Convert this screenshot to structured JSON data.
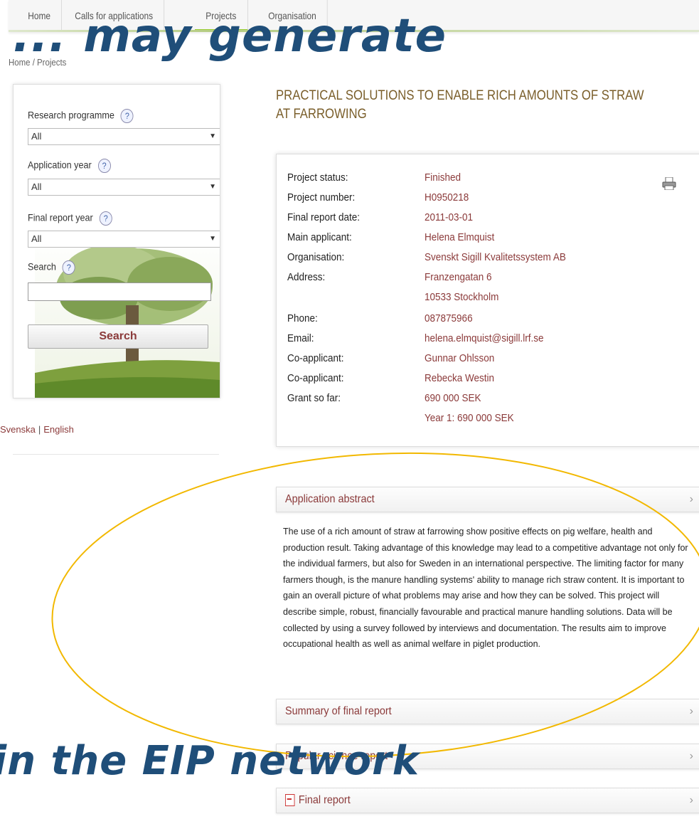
{
  "nav": {
    "items": [
      "Home",
      "Calls for applications",
      "Projects",
      "Organisation"
    ],
    "active": "Projects"
  },
  "overlay": {
    "top_text": "... may generate",
    "bottom_text": "in the EIP network"
  },
  "breadcrumb": "Home / Projects",
  "sidebar": {
    "research_programme_label": "Research programme",
    "research_programme_value": "All",
    "application_year_label": "Application year",
    "application_year_value": "All",
    "final_report_year_label": "Final report year",
    "final_report_year_value": "All",
    "search_label": "Search",
    "search_value": "",
    "search_button": "Search",
    "help_glyph": "?"
  },
  "language": {
    "svenska": "Svenska",
    "separator": "|",
    "english": "English"
  },
  "project": {
    "title": "PRACTICAL SOLUTIONS TO ENABLE RICH AMOUNTS OF STRAW AT FARROWING",
    "rows": [
      {
        "k": "Project status:",
        "v": "Finished"
      },
      {
        "k": "Project number:",
        "v": "H0950218"
      },
      {
        "k": "Final report date:",
        "v": "2011-03-01"
      },
      {
        "k": "Main applicant:",
        "v": "Helena Elmquist"
      },
      {
        "k": "Organisation:",
        "v": "Svenskt Sigill Kvalitetssystem AB"
      },
      {
        "k": "Address:",
        "v": "Franzengatan 6"
      },
      {
        "k": "",
        "v": "10533 Stockholm"
      },
      {
        "k": "Phone:",
        "v": "087875966"
      },
      {
        "k": "Email:",
        "v": "helena.elmquist@sigill.lrf.se"
      },
      {
        "k": "Co-applicant:",
        "v": "Gunnar Ohlsson"
      },
      {
        "k": "Co-applicant:",
        "v": "Rebecka Westin"
      },
      {
        "k": "Grant so far:",
        "v": "690 000 SEK"
      },
      {
        "k": "",
        "v": "Year 1: 690 000 SEK"
      }
    ]
  },
  "sections": {
    "application_abstract": "Application abstract",
    "abstract_text": "The use of a rich amount of straw at farrowing show positive effects on pig welfare, health and production result. Taking advantage of this knowledge may lead to a competitive advantage not only for the individual farmers, but also for Sweden in an international perspective. The limiting factor for many farmers though, is the manure handling systems' ability to manage rich straw content. It is important to gain an overall picture of what problems may arise and how they can be solved. This project will describe simple, robust, financially favourable and practical manure handling solutions. Data will be collected by using a survey followed by interviews and documentation. The results aim to improve occupational health as well as animal welfare in piglet production.",
    "summary_final_report": "Summary of final report",
    "popular_science_report": "Popular science report",
    "final_report": "Final report",
    "chevron": "›"
  },
  "colors": {
    "link": "#8b3a3a",
    "title": "#7a5e2a",
    "overlay_text": "#1f4e79",
    "ellipse": "#f2b800"
  }
}
